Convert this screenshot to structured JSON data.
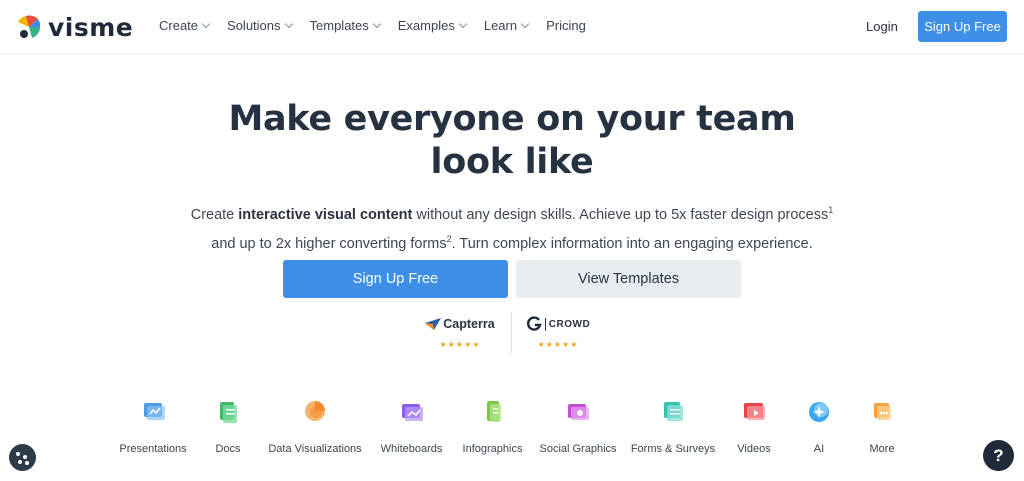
{
  "brand": {
    "name": "visme"
  },
  "nav": {
    "items": [
      {
        "label": "Create",
        "dropdown": true
      },
      {
        "label": "Solutions",
        "dropdown": true
      },
      {
        "label": "Templates",
        "dropdown": true
      },
      {
        "label": "Examples",
        "dropdown": true
      },
      {
        "label": "Learn",
        "dropdown": true
      },
      {
        "label": "Pricing",
        "dropdown": false
      }
    ],
    "login": "Login",
    "signup": "Sign Up Free"
  },
  "hero": {
    "title_line1": "Make everyone on your team",
    "title_line2": "look like",
    "sub_pre": "Create ",
    "sub_bold": "interactive visual content",
    "sub_mid": " without any design skills. Achieve up to 5x faster design process",
    "sup1": "1",
    "sub_line2_pre": "and up to 2x higher converting forms",
    "sup2": "2",
    "sub_line2_post": ". Turn complex information into an engaging experience.",
    "primary_button": "Sign Up Free",
    "secondary_button": "View Templates"
  },
  "ratings": [
    {
      "name": "Capterra",
      "stars": "★★★★★"
    },
    {
      "name": "CROWD",
      "stars": "★★★★★"
    }
  ],
  "features": [
    {
      "label": "Presentations",
      "color": "#4a9be8"
    },
    {
      "label": "Docs",
      "color": "#3dbb6b"
    },
    {
      "label": "Data Visualizations",
      "color": "#f28b2c"
    },
    {
      "label": "Whiteboards",
      "color": "#8a5cf0"
    },
    {
      "label": "Infographics",
      "color": "#7ac943"
    },
    {
      "label": "Social Graphics",
      "color": "#c64fd8"
    },
    {
      "label": "Forms & Surveys",
      "color": "#34c2b0"
    },
    {
      "label": "Videos",
      "color": "#e8414a"
    },
    {
      "label": "AI",
      "color": "#3aa7f2"
    },
    {
      "label": "More",
      "color": "#f5a33a"
    }
  ],
  "help": {
    "label": "?"
  }
}
